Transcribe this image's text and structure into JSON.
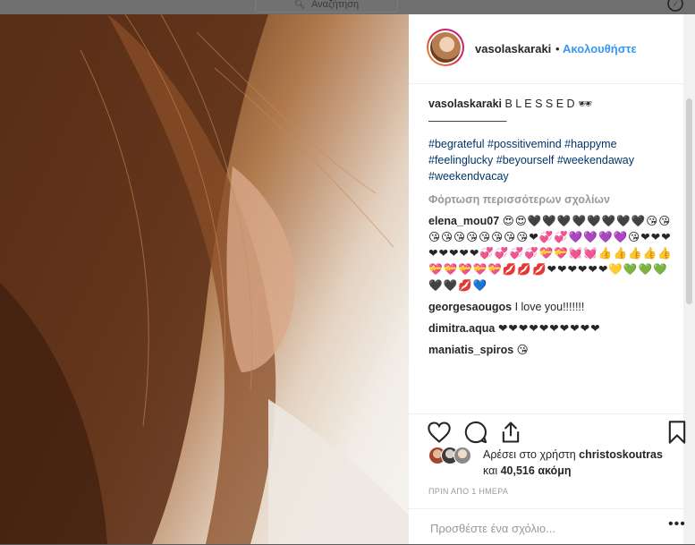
{
  "topbar": {
    "search_placeholder": "Αναζήτηση"
  },
  "post": {
    "username": "vasolaskaraki",
    "separator": "•",
    "follow_label": "Ακολουθήστε",
    "caption_user": "vasolaskaraki",
    "caption_text": "B L E S S E D 🕶",
    "caption_line": "———————",
    "hashtags": [
      "#begrateful #possitivemind #happyme",
      "#feelinglucky #beyourself #weekendaway",
      "#weekendvacay"
    ],
    "load_more": "Φόρτωση περισσότερων σχολίων",
    "comments": [
      {
        "user": "elena_mou07",
        "text": "😍😍🖤🖤🖤🖤🖤🖤🖤🖤😘😘😘😘😘😘😘😘😘😘❤💞💞💜💜💜💜😘❤❤❤❤❤❤❤❤💞💞💞💞💝💝💓💓👍👍👍👍👍💝💝💝💝💝💋💋💋❤❤❤❤❤❤💛💚💚💚🖤🖤💋💙"
      },
      {
        "user": "georgesaougos",
        "text": "I love you!!!!!!!"
      },
      {
        "user": "dimitra.aqua",
        "text": "❤❤❤❤❤❤❤❤❤❤"
      },
      {
        "user": "maniatis_spiros",
        "text": "😘"
      }
    ],
    "likes_prefix": "Αρέσει στο χρήστη",
    "likes_user": "christoskoutras",
    "likes_and": "και",
    "likes_count": "40,516",
    "likes_suffix": "ακόμη",
    "timestamp": "ΠΡΙΝ ΑΠΟ 1 ΗΜΕΡΑ",
    "comment_placeholder": "Προσθέστε ένα σχόλιο...",
    "more_dots": "•••"
  },
  "colors": {
    "link": "#3897f0",
    "hashtag": "#003569",
    "muted": "#999999",
    "text": "#262626"
  },
  "icons": [
    "search-icon",
    "compass-icon",
    "heart-icon",
    "comment-icon",
    "share-icon",
    "bookmark-icon",
    "more-icon"
  ]
}
